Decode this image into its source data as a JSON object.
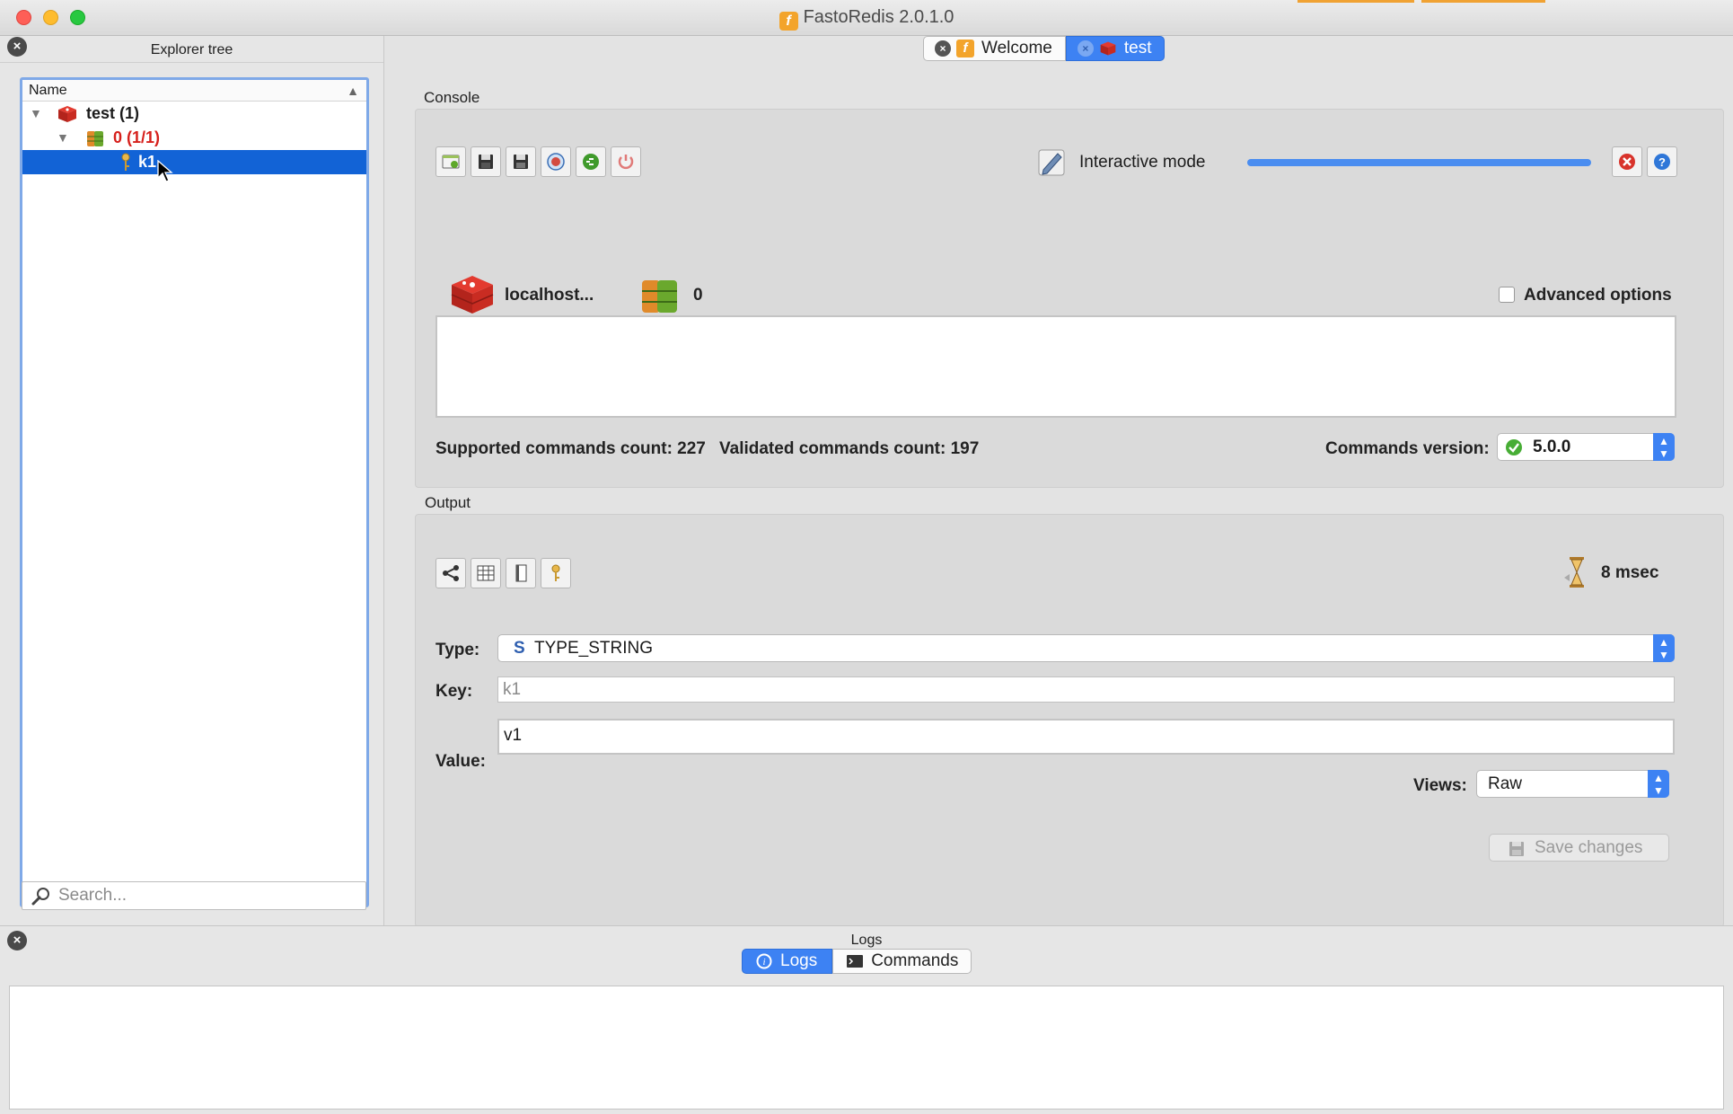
{
  "window": {
    "title": "FastoRedis 2.0.1.0",
    "app_icon_glyph": "f"
  },
  "explorer": {
    "title": "Explorer tree",
    "column_header": "Name",
    "tree": [
      {
        "label": "test (1)",
        "icon": "redis-server-icon",
        "expanded": true
      },
      {
        "label": "0 (1/1)",
        "icon": "database-icon",
        "expanded": true,
        "color": "#d6201c"
      },
      {
        "label": "k1",
        "icon": "key-icon",
        "selected": true
      }
    ],
    "search_placeholder": "Search..."
  },
  "tabs": [
    {
      "label": "Welcome",
      "icon": "fastoredis-icon",
      "active": false
    },
    {
      "label": "test",
      "icon": "redis-server-icon",
      "active": true
    }
  ],
  "console": {
    "group_label": "Console",
    "toolbar_icons": [
      "load-icon",
      "save-icon",
      "save-as-icon",
      "connect-icon",
      "execute-icon",
      "stop-icon"
    ],
    "interactive_mode_label": "Interactive mode",
    "progress": 1.0,
    "server_label": "localhost...",
    "db_label": "0",
    "advanced_options_label": "Advanced options",
    "advanced_checked": false,
    "supported_commands": "Supported commands count: 227",
    "validated_commands": "Validated commands count: 197",
    "commands_version_label": "Commands version:",
    "commands_version_value": "5.0.0"
  },
  "output": {
    "group_label": "Output",
    "toolbar_icons": [
      "tree-view-icon",
      "table-view-icon",
      "text-view-icon",
      "key-view-icon"
    ],
    "time_label": "8 msec",
    "type_label": "Type:",
    "type_value": "TYPE_STRING",
    "key_label": "Key:",
    "key_value": "k1",
    "value_label": "Value:",
    "value_value": "v1",
    "views_label": "Views:",
    "views_value": "Raw",
    "save_label": "Save changes"
  },
  "logs": {
    "title": "Logs",
    "tabs": [
      {
        "label": "Logs",
        "active": true
      },
      {
        "label": "Commands",
        "active": false
      }
    ]
  },
  "colors": {
    "accent": "#3d82f3",
    "selection": "#1263d6",
    "danger": "#d6201c"
  }
}
